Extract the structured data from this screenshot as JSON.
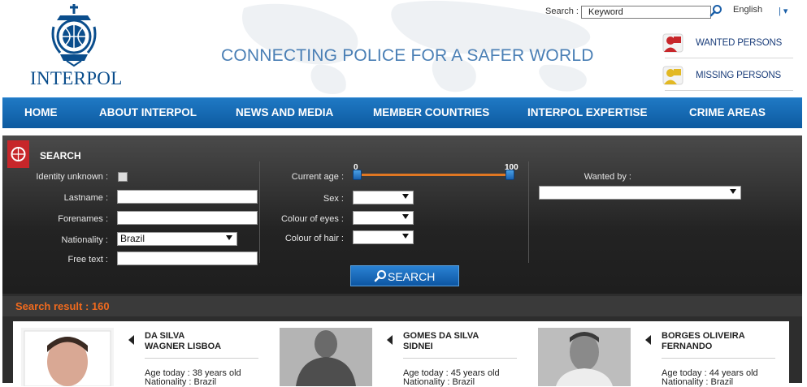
{
  "header": {
    "logo_text": "INTERPOL",
    "tagline": "CONNECTING POLICE FOR A SAFER WORLD",
    "search_label": "Search :",
    "search_placeholder": "Keyword",
    "language": "English",
    "language_separator": "| ▾",
    "links": [
      {
        "label": "WANTED PERSONS",
        "icon": "wanted-person-icon"
      },
      {
        "label": "MISSING PERSONS",
        "icon": "missing-person-icon"
      }
    ]
  },
  "nav": {
    "items": [
      "HOME",
      "ABOUT INTERPOL",
      "NEWS AND MEDIA",
      "MEMBER COUNTRIES",
      "INTERPOL EXPERTISE",
      "CRIME AREAS"
    ]
  },
  "search_panel": {
    "title": "SEARCH",
    "fields": {
      "identity_unknown": "Identity unknown :",
      "lastname": "Lastname :",
      "forenames": "Forenames :",
      "nationality": "Nationality :",
      "nationality_value": "Brazil",
      "free_text": "Free text :",
      "current_age": "Current age :",
      "age_min": "0",
      "age_max": "100",
      "sex": "Sex :",
      "colour_of_eyes": "Colour of eyes :",
      "colour_of_hair": "Colour of hair :",
      "wanted_by": "Wanted by :"
    },
    "search_button": "SEARCH"
  },
  "results": {
    "label": "Search result : 160",
    "cards": [
      {
        "name_line1": "DA SILVA",
        "name_line2": "WAGNER LISBOA",
        "age": "Age today : 38 years old",
        "nationality": "Nationality : Brazil"
      },
      {
        "name_line1": "GOMES DA SILVA",
        "name_line2": "SIDNEI",
        "age": "Age today : 45 years old",
        "nationality": "Nationality : Brazil"
      },
      {
        "name_line1": "BORGES OLIVEIRA",
        "name_line2": "FERNANDO",
        "age": "Age today : 44 years old",
        "nationality": "Nationality : Brazil"
      }
    ]
  },
  "colors": {
    "brand_blue": "#0d5aa0",
    "accent_orange": "#f06a1e",
    "icon_red": "#c7262a"
  }
}
